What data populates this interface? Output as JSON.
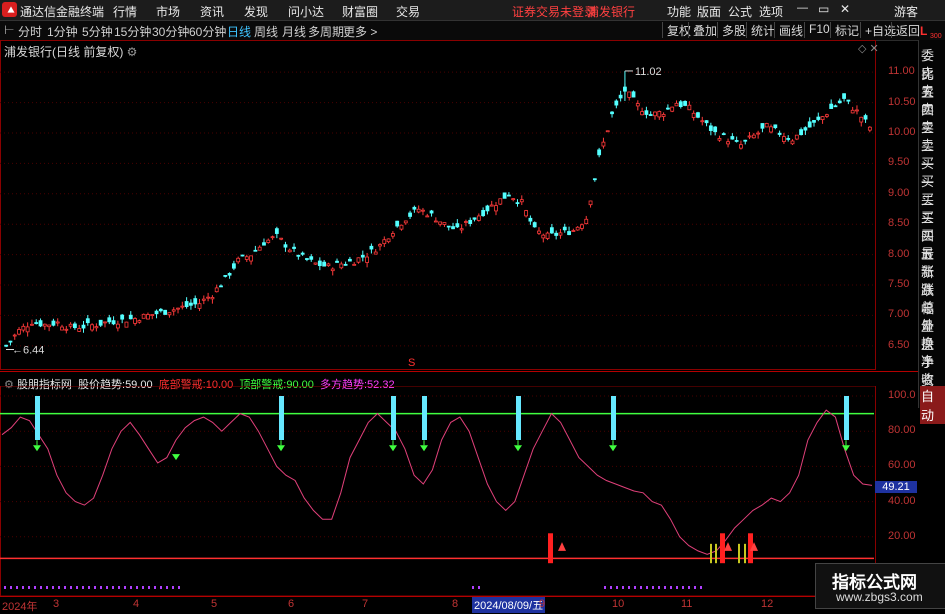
{
  "titlebar": {
    "app_name": "通达信金融终端",
    "menus": [
      "行情",
      "市场",
      "资讯",
      "发现",
      "问小达",
      "财富圈",
      "交易"
    ],
    "status": "证券交易未登录",
    "stock": "浦发银行",
    "right_menus": [
      "功能",
      "版面",
      "公式",
      "选项"
    ],
    "user": "游客"
  },
  "toolbar": {
    "periods": [
      "分时",
      "1分钟",
      "5分钟",
      "15分钟",
      "30分钟",
      "60分钟",
      "日线",
      "周线",
      "月线",
      "多周期",
      "更多 >"
    ],
    "active_period": "日线",
    "right_buttons": [
      "复权",
      "叠加",
      "多股",
      "统计",
      "画线",
      "F10",
      "标记",
      "+自选",
      "返回"
    ]
  },
  "side_panel": {
    "top_label": "L",
    "top_sub": "300",
    "items": [
      "委比",
      "卖五",
      "卖四",
      "卖三",
      "卖二",
      "卖一",
      "买一",
      "买二",
      "买三",
      "买四",
      "买五",
      "最新",
      "涨跌",
      "涨幅",
      "总量",
      "外盘",
      "换手",
      "净资",
      "收益"
    ],
    "auto": "自动"
  },
  "main_chart": {
    "title": "浦发银行(日线 前复权)",
    "high_label": "11.02",
    "low_label": "6.44",
    "marker": "S",
    "y_ticks": [
      "11.00",
      "10.50",
      "10.00",
      "9.50",
      "9.00",
      "8.50",
      "8.00",
      "7.50",
      "7.00",
      "6.50"
    ]
  },
  "indicator": {
    "name": "股朋指标网",
    "items": [
      {
        "label": "股价趋势:",
        "value": "59.00",
        "color": "#e8e8e8"
      },
      {
        "label": "底部警戒:",
        "value": "10.00",
        "color": "#ff3030"
      },
      {
        "label": "顶部警戒:",
        "value": "90.00",
        "color": "#40ff40"
      },
      {
        "label": "多方趋势:",
        "value": "52.32",
        "color": "#ff40ff"
      }
    ],
    "current_value": "49.21",
    "y_ticks": [
      "100.0",
      "80.00",
      "60.00",
      "40.00",
      "20.00"
    ]
  },
  "x_axis": {
    "labels": [
      "2024年",
      "3",
      "4",
      "5",
      "6",
      "7",
      "8",
      "9",
      "10",
      "11",
      "12"
    ],
    "highlight": "2024/08/09/五"
  },
  "watermark": {
    "title": "指标公式网",
    "url": "www.zbgs3.com"
  },
  "chart_data": [
    {
      "type": "candlestick",
      "title": "浦发银行(日线 前复权)",
      "y_range": [
        6.3,
        11.2
      ],
      "close_path": [
        6.5,
        6.75,
        6.9,
        6.85,
        6.88,
        6.8,
        6.82,
        6.85,
        6.9,
        6.92,
        6.95,
        7.0,
        7.05,
        7.1,
        7.15,
        7.2,
        7.35,
        7.6,
        7.9,
        8.0,
        8.2,
        8.3,
        8.1,
        7.95,
        7.85,
        7.8,
        7.85,
        7.9,
        8.0,
        8.15,
        8.4,
        8.6,
        8.75,
        8.65,
        8.5,
        8.4,
        8.55,
        8.7,
        8.85,
        9.0,
        8.85,
        8.4,
        8.3,
        8.35,
        8.4,
        8.6,
        9.6,
        10.3,
        10.7,
        10.45,
        10.3,
        10.35,
        10.5,
        10.4,
        10.2,
        10.0,
        9.9,
        9.8,
        9.95,
        10.1,
        10.0,
        9.9,
        10.05,
        10.2,
        10.4,
        10.55,
        10.35,
        10.1
      ],
      "high": 11.02,
      "low": 6.44
    },
    {
      "type": "line",
      "name": "多方趋势",
      "y_range": [
        0,
        100
      ],
      "top_warning": 90,
      "bottom_warning": 10,
      "values": [
        78,
        82,
        88,
        86,
        78,
        70,
        55,
        45,
        40,
        38,
        42,
        55,
        70,
        80,
        85,
        78,
        70,
        62,
        65,
        75,
        82,
        86,
        88,
        85,
        80,
        85,
        90,
        88,
        80,
        70,
        60,
        55,
        52,
        42,
        35,
        30,
        30,
        45,
        65,
        75,
        85,
        90,
        85,
        80,
        70,
        55,
        50,
        58,
        75,
        85,
        88,
        80,
        65,
        50,
        40,
        35,
        40,
        55,
        70,
        80,
        90,
        85,
        75,
        65,
        60,
        55,
        52,
        50,
        48,
        46,
        45,
        40,
        38,
        30,
        20,
        15,
        12,
        10,
        12,
        18,
        25,
        30,
        35,
        38,
        42,
        40,
        45,
        55,
        75,
        85,
        92,
        88,
        70,
        55,
        50,
        49.21
      ]
    }
  ]
}
